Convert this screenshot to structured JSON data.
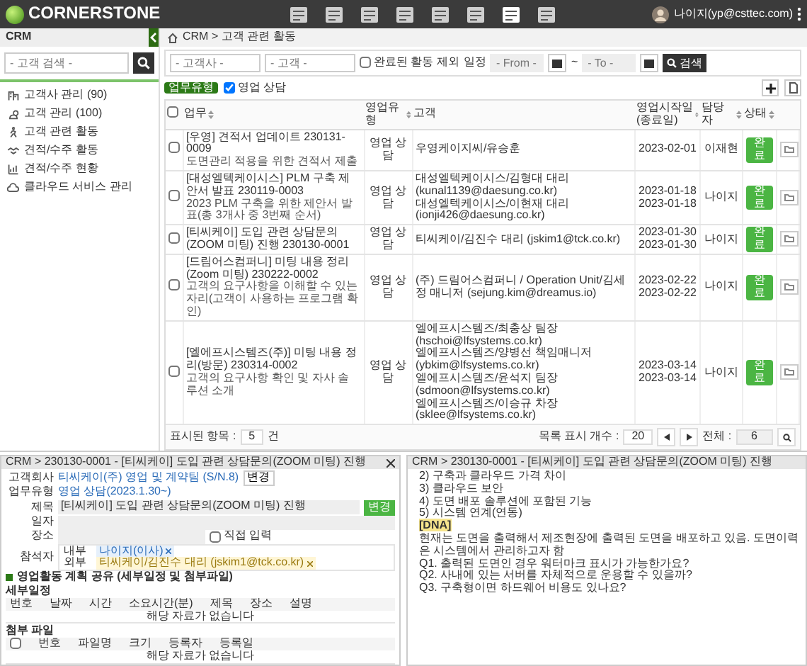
{
  "header": {
    "logo": "CORNERSTONE",
    "user": "나이지(yp@csttec.com)"
  },
  "sidebar": {
    "title": "CRM",
    "search": {
      "placeholder": "- 고객 검색 -"
    },
    "items": [
      {
        "label": "고객사 관리 (90)"
      },
      {
        "label": "고객 관리 (100)"
      },
      {
        "label": "고객 관련 활동"
      },
      {
        "label": "견적/수주 활동"
      },
      {
        "label": "견적/수주 현황"
      },
      {
        "label": "클라우드 서비스 관리"
      }
    ]
  },
  "breadcrumb": "CRM > 고객 관련 활동",
  "filters": {
    "company": {
      "placeholder": "- 고객사 -"
    },
    "customer": {
      "placeholder": "- 고객 -"
    },
    "exclude_done": {
      "label": "완료된 활동 제외",
      "checked": false
    },
    "schedule_label": "일정",
    "from": {
      "placeholder": "- From -"
    },
    "tilde": "~",
    "to": {
      "placeholder": "- To -"
    },
    "search_button": "검색"
  },
  "type_filter": {
    "badge": "업무유형",
    "options": [
      {
        "label": "영업 상담",
        "checked": true
      }
    ]
  },
  "table": {
    "all_selected": false,
    "columns": [
      {
        "label": "업무",
        "sortable": true
      },
      {
        "label": "영업유형",
        "sortable": true
      },
      {
        "label": "고객",
        "sortable": false
      },
      {
        "label": "영업시작일(종료일)",
        "sortable": true
      },
      {
        "label": "담당자",
        "sortable": true
      },
      {
        "label": "상태",
        "sortable": true
      }
    ],
    "rows": [
      {
        "selected": false,
        "title": "[우영] 견적서 업데이트 230131-0009",
        "desc": "도면관리 적용을 위한 견적서 제출",
        "type": "영업 상담",
        "customers": [
          "우영케이지씨/유승훈"
        ],
        "dates": [
          "2023-02-01"
        ],
        "owner": "이재현",
        "status": "완료",
        "done": true
      },
      {
        "selected": false,
        "title": "[대성엘텍케이시스] PLM 구축 제안서 발표 230119-0003",
        "desc": "2023 PLM 구축을 위한 제안서 발표(총 3개사 중 3번째 순서)",
        "type": "영업 상담",
        "customers": [
          "대성엘텍케이시스/김형대 대리 (kunal1139@daesung.co.kr)",
          "대성엘텍케이시스/이현재 대리 (ionji426@daesung.co.kr)"
        ],
        "dates": [
          "2023-01-18",
          "2023-01-18"
        ],
        "owner": "나이지",
        "status": "완료",
        "done": true
      },
      {
        "selected": false,
        "title": "[티씨케이] 도입 관련 상담문의(ZOOM 미팅) 진행 230130-0001",
        "type": "영업 상담",
        "customers": [
          "티씨케이/김진수 대리 (jskim1@tck.co.kr)"
        ],
        "dates": [
          "2023-01-30",
          "2023-01-30"
        ],
        "owner": "나이지",
        "status": "완료",
        "done": true
      },
      {
        "selected": false,
        "title": "[드림어스컴퍼니] 미팅 내용 정리(Zoom 미팅) 230222-0002",
        "desc": "고객의 요구사항을 이해할 수 있는 자리(고객이 사용하는 프로그램 확인)",
        "type": "영업 상담",
        "customers": [
          "(주) 드림어스컴퍼니 / Operation Unit/김세정 매니저 (sejung.kim@dreamus.io)"
        ],
        "dates": [
          "2023-02-22",
          "2023-02-22"
        ],
        "owner": "나이지",
        "status": "완료",
        "done": true
      },
      {
        "selected": false,
        "title": "[엘에프시스템즈(주)] 미팅 내용 정리(방문) 230314-0002",
        "desc": "고객의 요구사항 확인 및 자사 솔루션 소개",
        "type": "영업 상담",
        "customers": [
          "엘에프시스템즈/최충상 팀장 (hschoi@lfsystems.co.kr)",
          "엘에프시스템즈/양병선 책임매니저 (ybkim@lfsystems.co.kr)",
          "엘에프시스템즈/윤석지 팀장 (sdmoon@lfsystems.co.kr)",
          "엘에프시스템즈/이승규 차장 (sklee@lfsystems.co.kr)"
        ],
        "dates": [
          "2023-03-14",
          "2023-03-14"
        ],
        "owner": "나이지",
        "status": "완료",
        "done": true
      }
    ]
  },
  "footer": {
    "shown_label": "표시된 항목 :",
    "shown": "5",
    "unit": "건",
    "page_size_label": "목록 표시 개수 :",
    "page_size": "20",
    "total_label": "전체 :",
    "total": "6"
  },
  "detail": {
    "breadcrumb": "CRM > 230130-0001 - [티씨케이] 도입 관련 상담문의(ZOOM 미팅) 진행",
    "fields": [
      {
        "kind": "link",
        "label": "고객회사",
        "value": "티씨케이(주) 영업 및 계약팀 (S/N.8)",
        "button": "변경"
      },
      {
        "kind": "link",
        "label": "업무유형",
        "value": "영업 상담(2023.1.30~)"
      },
      {
        "kind": "input",
        "label": "제목",
        "value": "[티씨케이] 도입 관련 상담문의(ZOOM 미팅) 진행",
        "button": "변경"
      },
      {
        "kind": "input",
        "label": "일자"
      },
      {
        "kind": "place",
        "label": "장소",
        "check": {
          "label": "직접 입력",
          "checked": false
        }
      },
      {
        "kind": "attendees",
        "label": "참석자",
        "groups": [
          {
            "label": "내부",
            "chips": [
              "나이지(이사)"
            ]
          },
          {
            "label": "외부",
            "chips": [
              "티씨케이/김진수 대리 (jskim1@tck.co.kr)"
            ]
          }
        ]
      }
    ],
    "section_title": "영업활동 계획 공유 (세부일정 및 첨부파일)",
    "subtables": [
      {
        "title": "세부일정",
        "checkbox": false,
        "columns": [
          "번호",
          "날짜",
          "시간",
          "소요시간(분)",
          "제목",
          "장소",
          "설명"
        ],
        "empty": "해당 자료가 없습니다"
      },
      {
        "title": "첨부 파일",
        "checkbox": true,
        "columns": [
          "번호",
          "파일명",
          "크기",
          "등록자",
          "등록일"
        ],
        "empty": "해당 자료가 없습니다"
      }
    ]
  },
  "notes": {
    "breadcrumb": "CRM > 230130-0001 - [티씨케이] 도입 관련 상담문의(ZOOM 미팅) 진행",
    "lines": [
      {
        "kind": "text",
        "text": "2) 구축과 클라우드 가격 차이"
      },
      {
        "kind": "text",
        "text": "3) 클라우드 보안"
      },
      {
        "kind": "text",
        "text": "4) 도면 배포 솔루션에 포함된 기능"
      },
      {
        "kind": "text",
        "text": "5) 시스템 연계(연동)"
      },
      {
        "kind": "tag",
        "text": "[DNA]"
      },
      {
        "kind": "text",
        "text": "현재는 도면을 출력해서 제조현장에 출력된 도면을 배포하고 있음. 도면이력은 시스템에서 관리하고자 함"
      },
      {
        "kind": "text",
        "text": "Q1. 출력된 도면인 경우 워터마크 표시가 가능한가요?"
      },
      {
        "kind": "text",
        "text": "Q2. 사내에 있는 서버를 자체적으로 운용할 수 있을까?"
      },
      {
        "kind": "text",
        "text": "Q3. 구축형이면 하드웨어 비용도 있나요?"
      }
    ]
  }
}
